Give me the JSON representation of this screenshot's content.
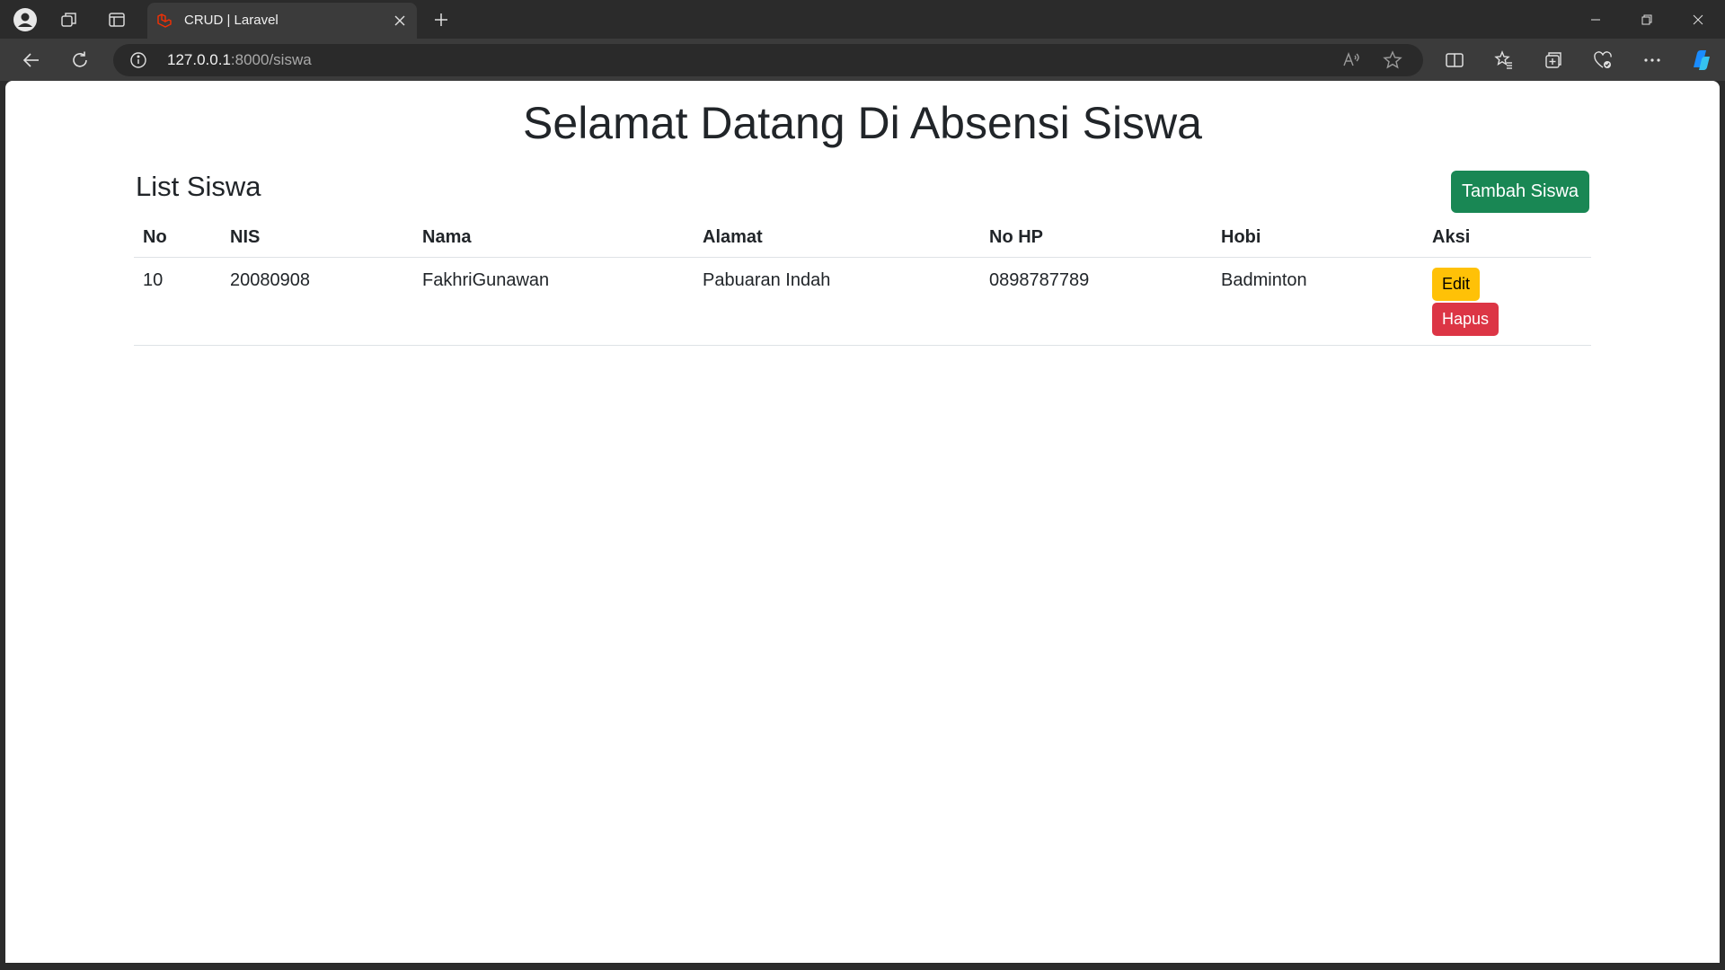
{
  "browser": {
    "tab": {
      "title": "CRUD | Laravel",
      "favicon": "laravel-logo-icon"
    },
    "url": {
      "host": "127.0.0.1",
      "rest": ":8000/siswa"
    }
  },
  "page": {
    "title": "Selamat Datang Di Absensi Siswa",
    "section_title": "List Siswa",
    "add_button": "Tambah Siswa",
    "table": {
      "headers": [
        "No",
        "NIS",
        "Nama",
        "Alamat",
        "No HP",
        "Hobi",
        "Aksi"
      ],
      "rows": [
        {
          "no": "10",
          "nis": "20080908",
          "nama": "FakhriGunawan",
          "alamat": "Pabuaran Indah",
          "no_hp": "0898787789",
          "hobi": "Badminton",
          "actions": {
            "edit": "Edit",
            "delete": "Hapus"
          }
        }
      ]
    }
  },
  "colors": {
    "success": "#198754",
    "warning": "#ffc107",
    "danger": "#dc3545",
    "laravel_red": "#f53003"
  }
}
